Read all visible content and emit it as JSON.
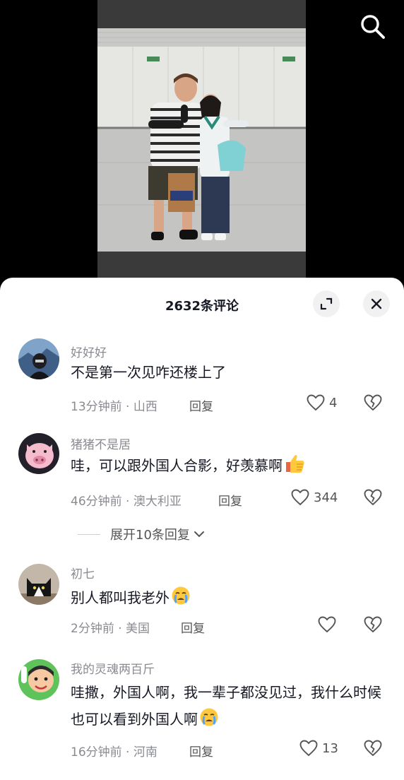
{
  "sheet": {
    "title": "2632条评论"
  },
  "comments": [
    {
      "username": "好好好",
      "text": "不是第一次见咋还楼上了",
      "time": "13分钟前 · 山西",
      "reply": "回复",
      "likes": "4",
      "avatar": "person-avatar"
    },
    {
      "username": "猪猪不是居",
      "text": "哇，可以跟外国人合影，好羡慕啊",
      "time": "46分钟前 · 澳大利亚",
      "reply": "回复",
      "likes": "344",
      "avatar": "pig-avatar",
      "emoji": "thumbs-up"
    },
    {
      "username": "初七",
      "text": "别人都叫我老外",
      "time": "2分钟前 · 美国",
      "reply": "回复",
      "likes": "",
      "avatar": "cat-avatar",
      "emoji": "crying-face"
    },
    {
      "username": "我的灵魂两百斤",
      "text": "哇撒，外国人啊，我一辈子都没见过，我什么时候也可以看到外国人啊",
      "time": "16分钟前 · 河南",
      "reply": "回复",
      "likes": "13",
      "avatar": "cartoon-avatar",
      "emoji": "crying-face"
    }
  ],
  "expand_replies": {
    "label": "展开10条回复"
  },
  "icons": {
    "search": "search-icon",
    "expand": "expand-icon",
    "close": "close-icon",
    "like": "heart-icon",
    "dislike": "broken-heart-icon"
  },
  "colors": {
    "sheet_bg": "#ffffff",
    "text_primary": "#161823",
    "text_secondary": "#8a8b91"
  }
}
